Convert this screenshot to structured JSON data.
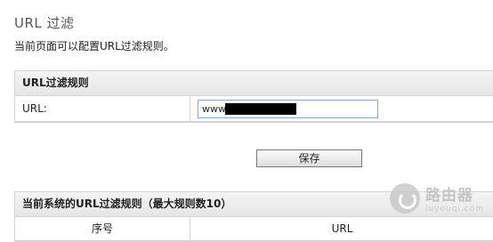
{
  "page": {
    "title": "URL 过滤",
    "description": "当前页面可以配置URL过滤规则。"
  },
  "rule_panel": {
    "header": "URL过滤规则",
    "url_label": "URL:",
    "url_value": "www."
  },
  "save_label": "保存",
  "rules_table": {
    "header": "当前系统的URL过滤规则（最大规则数10）",
    "columns": [
      "序号",
      "URL"
    ]
  },
  "watermark": {
    "name": "路由器",
    "domain": "luyouqi.com"
  }
}
